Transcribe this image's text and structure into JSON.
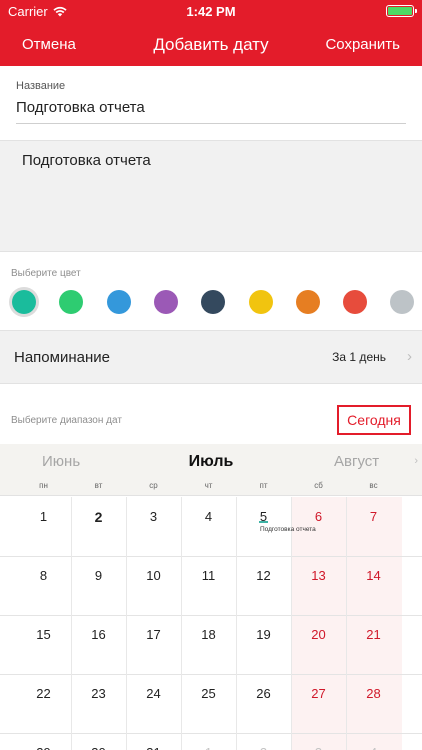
{
  "status_bar": {
    "carrier": "Carrier",
    "time": "1:42 PM"
  },
  "nav": {
    "cancel": "Отмена",
    "title": "Добавить дату",
    "save": "Сохранить"
  },
  "name_field": {
    "label": "Название",
    "value": "Подготовка отчета"
  },
  "notes": {
    "value": "Подготовка отчета"
  },
  "color_picker": {
    "label": "Выберите цвет",
    "selected": "#1abc9c",
    "colors": [
      "#1abc9c",
      "#2ecc71",
      "#3498db",
      "#9b59b6",
      "#34495e",
      "#f1c40f",
      "#e67e22",
      "#e74c3c",
      "#bdc3c7"
    ]
  },
  "reminder": {
    "label": "Напоминание",
    "value": "За 1 день"
  },
  "date_range": {
    "label": "Выберите диапазон дат",
    "today_button": "Сегодня"
  },
  "calendar": {
    "prev_month": "Июнь",
    "current_month": "Июль",
    "next_month": "Август",
    "weekdays": [
      "пн",
      "вт",
      "ср",
      "чт",
      "пт",
      "сб",
      "вс"
    ],
    "weeks": [
      [
        "1",
        "2",
        "3",
        "4",
        "5",
        "6",
        "7"
      ],
      [
        "8",
        "9",
        "10",
        "11",
        "12",
        "13",
        "14"
      ],
      [
        "15",
        "16",
        "17",
        "18",
        "19",
        "20",
        "21"
      ],
      [
        "22",
        "23",
        "24",
        "25",
        "26",
        "27",
        "28"
      ],
      [
        "29",
        "30",
        "31",
        "1",
        "2",
        "3",
        "4"
      ]
    ],
    "today": "2",
    "event": {
      "day": "5",
      "title": "Подготовка отчета"
    }
  },
  "colors": {
    "accent": "#e31c2a",
    "weekend": "#d0182a",
    "event_marker": "#3fb3a6"
  }
}
